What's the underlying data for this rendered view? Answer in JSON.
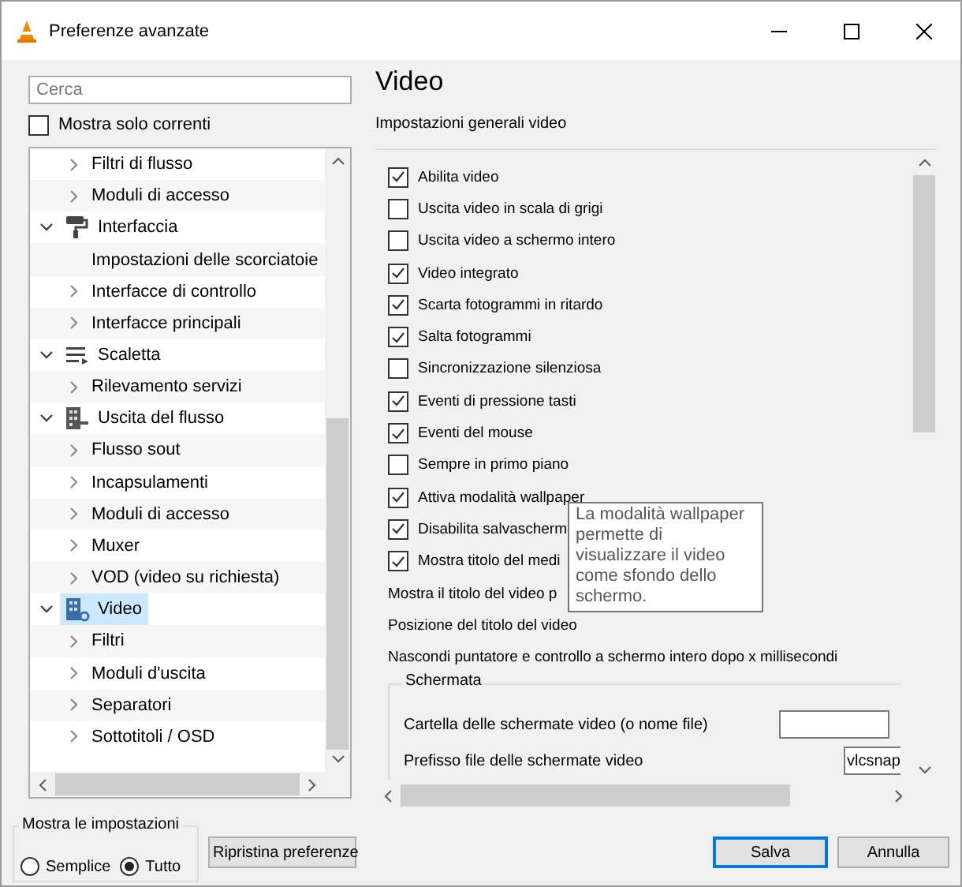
{
  "window": {
    "title": "Preferenze avanzate"
  },
  "sidebar": {
    "search": {
      "placeholder": "Cerca"
    },
    "show_current_only": {
      "label": "Mostra solo correnti",
      "checked": false
    },
    "tree": [
      {
        "children": [
          {
            "label": "Filtri di flusso",
            "expandable": true,
            "selected": false
          },
          {
            "label": "Moduli di accesso",
            "expandable": true,
            "selected": false
          }
        ]
      },
      {
        "label": "Interfaccia",
        "expandable": true,
        "expanded": true,
        "selected": false,
        "children": [
          {
            "label": "Impostazioni delle scorciatoie",
            "expandable": false,
            "selected": false
          },
          {
            "label": "Interfacce di controllo",
            "expandable": true,
            "selected": false
          },
          {
            "label": "Interfacce principali",
            "expandable": true,
            "selected": false
          }
        ]
      },
      {
        "label": "Scaletta",
        "expandable": true,
        "expanded": true,
        "selected": false,
        "children": [
          {
            "label": "Rilevamento servizi",
            "expandable": true,
            "selected": false
          }
        ]
      },
      {
        "label": "Uscita del flusso",
        "expandable": true,
        "expanded": true,
        "selected": false,
        "children": [
          {
            "label": "Flusso sout",
            "expandable": true,
            "selected": false
          },
          {
            "label": "Incapsulamenti",
            "expandable": true,
            "selected": false
          },
          {
            "label": "Moduli di accesso",
            "expandable": true,
            "selected": false
          },
          {
            "label": "Muxer",
            "expandable": true,
            "selected": false
          },
          {
            "label": "VOD (video su richiesta)",
            "expandable": true,
            "selected": false
          }
        ]
      },
      {
        "label": "Video",
        "expandable": true,
        "expanded": true,
        "selected": true,
        "children": [
          {
            "label": "Filtri",
            "expandable": true,
            "selected": false
          },
          {
            "label": "Moduli d'uscita",
            "expandable": true,
            "selected": false
          },
          {
            "label": "Separatori",
            "expandable": true,
            "selected": false
          },
          {
            "label": "Sottotitoli / OSD",
            "expandable": true,
            "selected": false
          }
        ]
      }
    ]
  },
  "panel": {
    "title": "Video",
    "section": "Impostazioni generali video",
    "options": [
      {
        "kind": "checkbox",
        "label": "Abilita video",
        "checked": true
      },
      {
        "kind": "checkbox",
        "label": "Uscita video in scala di grigi",
        "checked": false
      },
      {
        "kind": "checkbox",
        "label": "Uscita video a schermo intero",
        "checked": false
      },
      {
        "kind": "checkbox",
        "label": "Video integrato",
        "checked": true
      },
      {
        "kind": "checkbox",
        "label": "Scarta fotogrammi in ritardo",
        "checked": true
      },
      {
        "kind": "checkbox",
        "label": "Salta fotogrammi",
        "checked": true
      },
      {
        "kind": "checkbox",
        "label": "Sincronizzazione silenziosa",
        "checked": false
      },
      {
        "kind": "checkbox",
        "label": "Eventi di pressione tasti",
        "checked": true
      },
      {
        "kind": "checkbox",
        "label": "Eventi del mouse",
        "checked": true
      },
      {
        "kind": "checkbox",
        "label": "Sempre in primo piano",
        "checked": false
      },
      {
        "kind": "checkbox",
        "label": "Attiva modalità wallpaper",
        "checked": true
      },
      {
        "kind": "checkbox",
        "label": "Disabilita salvascherm",
        "checked": true
      },
      {
        "kind": "checkbox",
        "label": "Mostra titolo del medi",
        "checked": true
      },
      {
        "kind": "text",
        "label": "Mostra il titolo del video p"
      },
      {
        "kind": "text",
        "label": "Posizione del titolo del video"
      },
      {
        "kind": "text",
        "label": "Nascondi puntatore e controllo a schermo intero dopo x millisecondi"
      }
    ],
    "group": {
      "title": "Schermata",
      "fields": [
        {
          "label": "Cartella delle schermate video (o nome file)"
        },
        {
          "label": "Prefisso file delle schermate video",
          "value": "vlcsnap"
        }
      ]
    },
    "tooltip": "La modalità wallpaper permette di visualizzare il video come sfondo dello schermo."
  },
  "show_settings": {
    "title": "Mostra le impostazioni",
    "options": [
      {
        "label": "Semplice",
        "selected": false
      },
      {
        "label": "Tutto",
        "selected": true
      }
    ]
  },
  "buttons": [
    {
      "kind": "reset",
      "label": "Ripristina preferenze",
      "focused": false
    },
    {
      "kind": "save",
      "label": "Salva",
      "focused": true
    },
    {
      "kind": "cancel",
      "label": "Annulla",
      "focused": false
    }
  ]
}
